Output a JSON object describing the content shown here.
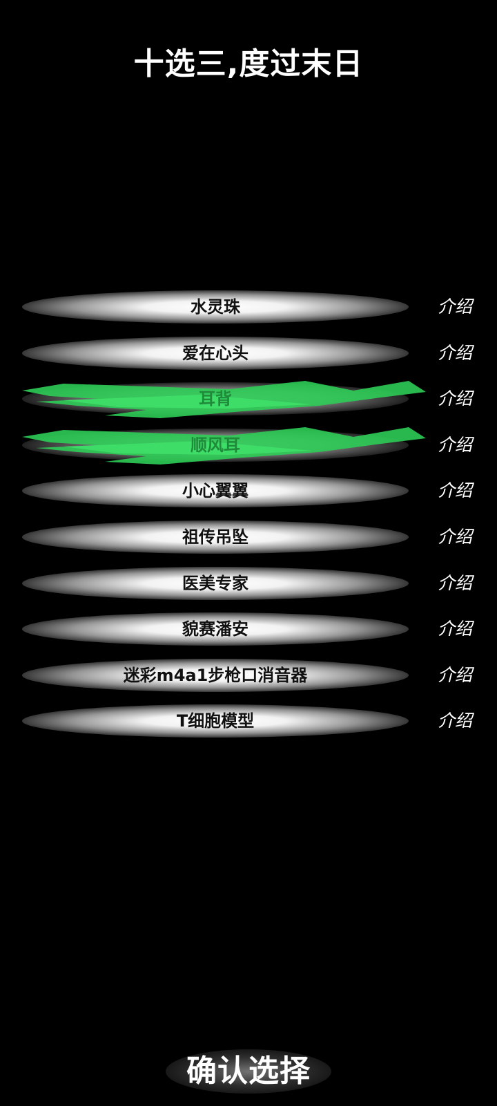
{
  "title": "十选三,度过末日",
  "items": [
    {
      "label": "水灵珠",
      "intro": "介绍",
      "selected": false
    },
    {
      "label": "爱在心头",
      "intro": "介绍",
      "selected": false
    },
    {
      "label": "耳背",
      "intro": "介绍",
      "selected": true
    },
    {
      "label": "顺风耳",
      "intro": "介绍",
      "selected": true
    },
    {
      "label": "小心翼翼",
      "intro": "介绍",
      "selected": false
    },
    {
      "label": "祖传吊坠",
      "intro": "介绍",
      "selected": false
    },
    {
      "label": "医美专家",
      "intro": "介绍",
      "selected": false
    },
    {
      "label": "貌赛潘安",
      "intro": "介绍",
      "selected": false
    },
    {
      "label": "迷彩m4a1步枪口消音器",
      "intro": "介绍",
      "selected": false
    },
    {
      "label": "T细胞模型",
      "intro": "介绍",
      "selected": false
    }
  ],
  "confirm_label": "确认选择",
  "colors": {
    "background": "#000000",
    "selected_green": "#2ecc55",
    "selected_text": "#1f8a3a"
  }
}
